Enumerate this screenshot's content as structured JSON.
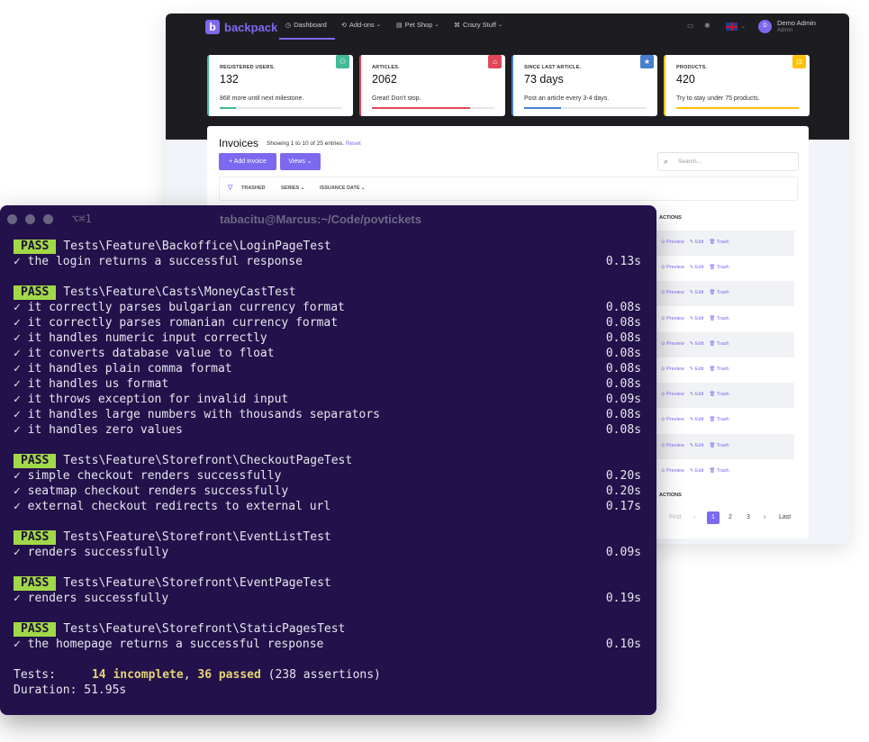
{
  "admin": {
    "brand": "backpack",
    "nav": [
      {
        "icon": "dashboard-icon",
        "glyph": "◷",
        "label": "Dashboard"
      },
      {
        "icon": "addons-icon",
        "glyph": "⟲",
        "label": "Add-ons"
      },
      {
        "icon": "petshop-icon",
        "glyph": "▤",
        "label": "Pet Shop"
      },
      {
        "icon": "crazystuff-icon",
        "glyph": "⌘",
        "label": "Crazy Stuff"
      }
    ],
    "user": {
      "name": "Demo Admin",
      "role": "Admin",
      "initial": "D"
    },
    "cards": [
      {
        "label": "REGISTERED USERS.",
        "value": "132",
        "desc": "868 more until next milestone.",
        "color": "#42ba96",
        "progress": 0.13,
        "icon": "user-icon",
        "glyph": "⚇"
      },
      {
        "label": "ARTICLES.",
        "value": "2062",
        "desc": "Great! Don't stop.",
        "color": "#df4759",
        "progress": 0.8,
        "icon": "tag-icon",
        "glyph": "⌂"
      },
      {
        "label": "SINCE LAST ARTICLE.",
        "value": "73 days",
        "desc": "Post an article every 3-4 days.",
        "color": "#467fd0",
        "progress": 0.3,
        "icon": "star-icon",
        "glyph": "★"
      },
      {
        "label": "PRODUCTS.",
        "value": "420",
        "desc": "Try to stay under 75 products.",
        "color": "#ffc107",
        "progress": 1.0,
        "icon": "lock-icon",
        "glyph": "⊡"
      }
    ],
    "invoices": {
      "title": "Invoices",
      "subtitle": "Showing 1 to 10 of 25 entries.",
      "reset": "Reset",
      "add_button": "+ Add invoice",
      "views_button": "Views ⌄",
      "search_placeholder": "Search...",
      "filters": [
        "TRASHED",
        "SERIES ⌄",
        "ISSUANCE DATE ⌄"
      ],
      "actions_header": "ACTIONS",
      "row_actions": [
        "⊙ Preview",
        "✎ Edit",
        "🗑 Trash"
      ],
      "pager": {
        "first": "First",
        "prev": "‹",
        "pages": [
          "1",
          "2",
          "3"
        ],
        "next": "›",
        "last": "Last"
      }
    }
  },
  "terminal": {
    "tab": "⌥⌘1",
    "title": "tabacitu@Marcus:~/Code/povtickets",
    "pass_label": "PASS",
    "groups": [
      {
        "suite": "Tests\\Feature\\Backoffice\\LoginPageTest",
        "tests": [
          {
            "name": "the login returns a successful response",
            "time": "0.13s"
          }
        ]
      },
      {
        "suite": "Tests\\Feature\\Casts\\MoneyCastTest",
        "tests": [
          {
            "name": "it correctly parses bulgarian currency format",
            "time": "0.08s"
          },
          {
            "name": "it correctly parses romanian currency format",
            "time": "0.08s"
          },
          {
            "name": "it handles numeric input correctly",
            "time": "0.08s"
          },
          {
            "name": "it converts database value to float",
            "time": "0.08s"
          },
          {
            "name": "it handles plain comma format",
            "time": "0.08s"
          },
          {
            "name": "it handles us format",
            "time": "0.08s"
          },
          {
            "name": "it throws exception for invalid input",
            "time": "0.09s"
          },
          {
            "name": "it handles large numbers with thousands separators",
            "time": "0.08s"
          },
          {
            "name": "it handles zero values",
            "time": "0.08s"
          }
        ]
      },
      {
        "suite": "Tests\\Feature\\Storefront\\CheckoutPageTest",
        "tests": [
          {
            "name": "simple checkout renders successfully",
            "time": "0.20s"
          },
          {
            "name": "seatmap checkout renders successfully",
            "time": "0.20s"
          },
          {
            "name": "external checkout redirects to external url",
            "time": "0.17s"
          }
        ]
      },
      {
        "suite": "Tests\\Feature\\Storefront\\EventListTest",
        "tests": [
          {
            "name": "renders successfully",
            "time": "0.09s"
          }
        ]
      },
      {
        "suite": "Tests\\Feature\\Storefront\\EventPageTest",
        "tests": [
          {
            "name": "renders successfully",
            "time": "0.19s"
          }
        ]
      },
      {
        "suite": "Tests\\Feature\\Storefront\\StaticPagesTest",
        "tests": [
          {
            "name": "the homepage returns a successful response",
            "time": "0.10s"
          }
        ]
      }
    ],
    "summary": {
      "tests_label": "Tests:",
      "incomplete": "14 incomplete",
      "passed": "36 passed",
      "assertions": "(238 assertions)",
      "duration_label": "Duration:",
      "duration": "51.95s"
    }
  }
}
